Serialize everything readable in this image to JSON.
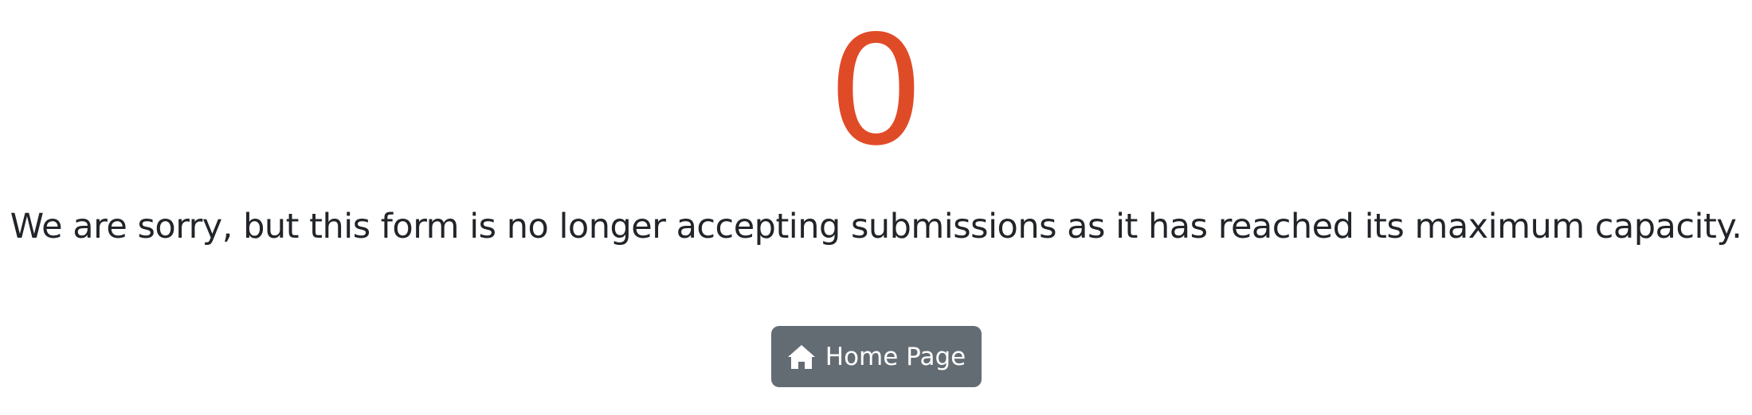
{
  "counter": {
    "value": "0",
    "color": "#e04b27"
  },
  "message": {
    "text": "We are sorry, but this form is no longer accepting submissions as it has reached its maximum capacity."
  },
  "home_button": {
    "label": "Home Page",
    "icon": "home-icon",
    "background": "#646c73"
  }
}
